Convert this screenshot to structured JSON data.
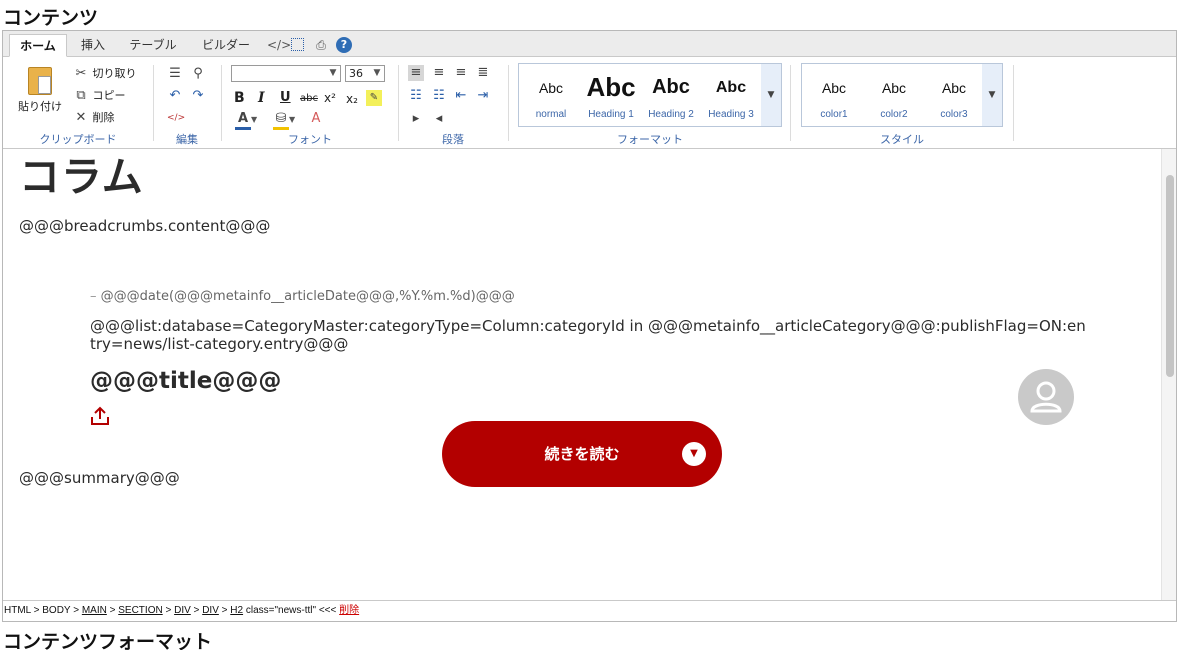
{
  "page": {
    "section_title": "コンテンツ",
    "section_title_bottom": "コンテンツフォーマット"
  },
  "ribbon": {
    "tabs": [
      {
        "label": "ホーム",
        "active": true
      },
      {
        "label": "挿入",
        "active": false
      },
      {
        "label": "テーブル",
        "active": false
      },
      {
        "label": "ビルダー",
        "active": false
      }
    ],
    "quick_icons": [
      "source-code-icon",
      "select-all-icon",
      "preview-icon",
      "help-icon"
    ],
    "clipboard": {
      "paste": "貼り付け",
      "cut": "切り取り",
      "copy": "コピー",
      "delete": "削除",
      "group_label": "クリップボード"
    },
    "edit": {
      "group_label": "編集"
    },
    "font": {
      "font_name_value": "",
      "font_size_value": "36",
      "bold": "B",
      "italic": "I",
      "underline": "U",
      "strike": "abc",
      "superscript": "x²",
      "subscript": "x₂",
      "group_label": "フォント"
    },
    "paragraph": {
      "group_label": "段落"
    },
    "format": {
      "items": [
        {
          "sample": "Abc",
          "label": "normal"
        },
        {
          "sample": "Abc",
          "label": "Heading 1"
        },
        {
          "sample": "Abc",
          "label": "Heading 2"
        },
        {
          "sample": "Abc",
          "label": "Heading 3"
        }
      ],
      "group_label": "フォーマット"
    },
    "style": {
      "items": [
        {
          "sample": "Abc",
          "label": "color1"
        },
        {
          "sample": "Abc",
          "label": "color2"
        },
        {
          "sample": "Abc",
          "label": "color3"
        }
      ],
      "group_label": "スタイル"
    }
  },
  "content": {
    "column_title": "コラム",
    "breadcrumbs": "@@@breadcrumbs.content@@@",
    "date_line": "@@@date(@@@metainfo__articleDate@@@,%Y.%m.%d)@@@",
    "list_line": "@@@list:database=CategoryMaster:categoryType=Column:categoryId in @@@metainfo__articleCategory@@@:publishFlag=ON:entry=news/list-category.entry@@@",
    "title": "@@@title@@@",
    "read_more": "続きを読む",
    "summary": "@@@summary@@@"
  },
  "statusbar": {
    "path": [
      "HTML",
      "BODY",
      "MAIN",
      "SECTION",
      "DIV",
      "DIV",
      "H2"
    ],
    "attrs": "class=\"news-ttl\"",
    "marker": "<<<",
    "delete": "削除"
  },
  "colors": {
    "accent_red": "#b30000",
    "ribbon_label_blue": "#3c66a8"
  }
}
